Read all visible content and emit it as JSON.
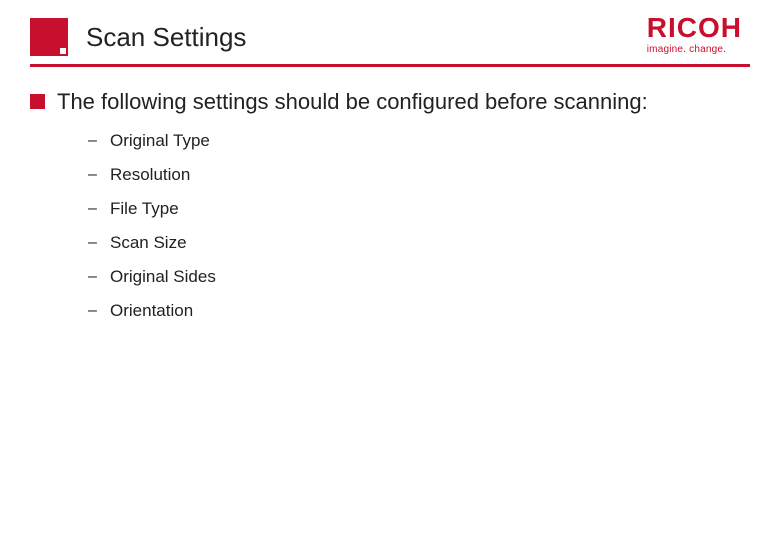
{
  "header": {
    "title": "Scan Settings",
    "logo_main": "RICOH",
    "logo_tagline": "imagine. change."
  },
  "content": {
    "intro": "The following settings should be configured before scanning:",
    "items": [
      "Original Type",
      "Resolution",
      "File Type",
      "Scan Size",
      "Original Sides",
      "Orientation"
    ]
  },
  "colors": {
    "brand": "#c8102e"
  }
}
